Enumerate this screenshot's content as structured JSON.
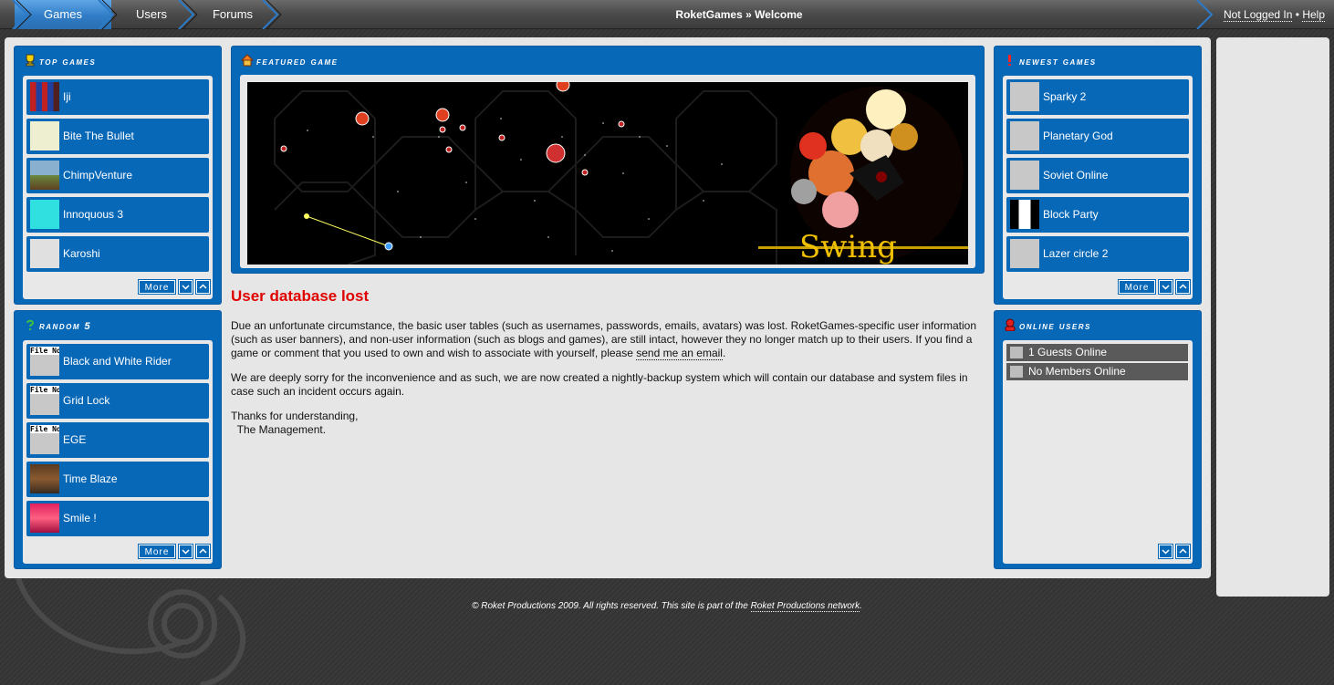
{
  "nav": {
    "tabs": [
      {
        "label": "Games",
        "active": true
      },
      {
        "label": "Users",
        "active": false
      },
      {
        "label": "Forums",
        "active": false
      }
    ],
    "title": "RoketGames » Welcome",
    "login_link": "Not Logged In",
    "separator": "•",
    "help_link": "Help"
  },
  "colors": {
    "panel_blue": "#0868b8",
    "accent_red": "#e00000",
    "frame_gray": "#e6e6e6"
  },
  "top_games": {
    "title": "Top Games",
    "icon": "trophy-icon",
    "items": [
      "Iji",
      "Bite The Bullet",
      "ChimpVenture",
      "Innoquous 3",
      "Karoshi"
    ],
    "more_label": "More"
  },
  "random_games": {
    "title": "Random 5",
    "icon": "question-icon",
    "items": [
      "Black and White Rider",
      "Grid Lock",
      "EGE",
      "Time Blaze",
      "Smile !"
    ],
    "thumb_placeholder": "File No",
    "more_label": "More"
  },
  "featured": {
    "title": "Featured Game",
    "icon": "house-icon",
    "banner_text": "Swing"
  },
  "article": {
    "title": "User database lost",
    "p1_text": "Due an unfortunate circumstance, the basic user tables (such as usernames, passwords, emails, avatars) was lost. RoketGames-specific user information (such as user banners), and non-user information (such as blogs and games), are still intact, however they no longer match up to their users. If you find a game or comment that you used to own and wish to associate with yourself, please ",
    "p1_link": "send me an email",
    "p1_end": ".",
    "p2": "We are deeply sorry for the inconvenience and as such, we are now created a nightly-backup system which will contain our database and system files in case such an incident occurs again.",
    "p3_line1": "Thanks for understanding,",
    "p3_line2": "The Management."
  },
  "newest_games": {
    "title": "Newest Games",
    "icon": "exclamation-icon",
    "items": [
      "Sparky 2",
      "Planetary God",
      "Soviet Online",
      "Block Party",
      "Lazer circle 2"
    ],
    "more_label": "More"
  },
  "online_users": {
    "title": "Online Users",
    "icon": "user-icon",
    "rows": [
      "1 Guests Online",
      "No Members Online"
    ]
  },
  "footer": {
    "text_before": "© Roket Productions 2009. All rights reserved. This site is part of the ",
    "link": "Roket Productions network",
    "text_after": "."
  }
}
